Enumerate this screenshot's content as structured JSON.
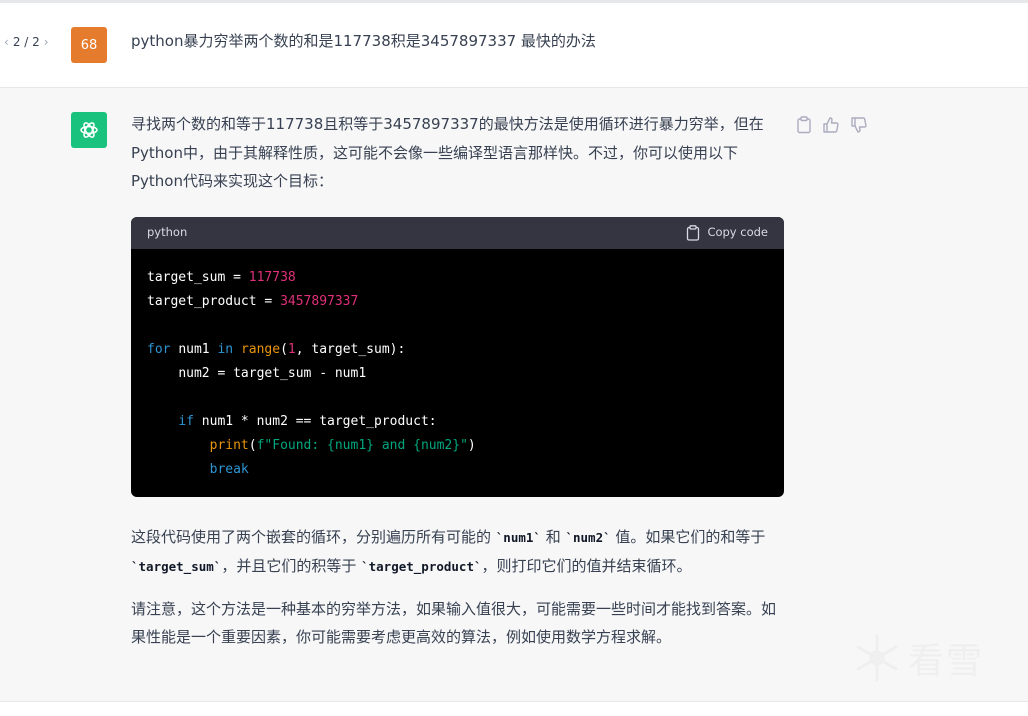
{
  "user": {
    "pager": "2 / 2",
    "avatar_text": "68",
    "message": "python暴力穷举两个数的和是117738积是3457897337 最快的办法"
  },
  "assistant": {
    "intro": "寻找两个数的和等于117738且积等于3457897337的最快方法是使用循环进行暴力穷举，但在Python中，由于其解释性质，这可能不会像一些编译型语言那样快。不过，你可以使用以下Python代码来实现这个目标：",
    "code": {
      "language": "python",
      "copy_label": "Copy code",
      "lines": {
        "l1": "target_sum",
        "l1v": "117738",
        "l2": "target_product",
        "l2v": "3457897337",
        "for_kw": "for",
        "num1": "num1",
        "in_kw": "in",
        "range_fn": "range",
        "range_start": "1",
        "range_rest": "target_sum):",
        "assign_num2": "num2 = target_sum - num1",
        "if_kw": "if",
        "if_rest": "num1 * num2 == target_product:",
        "print_fn": "print",
        "print_str": "f\"Found: {num1} and {num2}\"",
        "break_kw": "break"
      }
    },
    "para2": {
      "t1": "这段代码使用了两个嵌套的循环，分别遍历所有可能的 ",
      "c1": "`num1`",
      "t2": " 和 ",
      "c2": "`num2`",
      "t3": " 值。如果它们的和等于 ",
      "c3": "`target_sum`",
      "t4": "，并且它们的积等于 ",
      "c4": "`target_product`",
      "t5": "，则打印它们的值并结束循环。"
    },
    "para3": "请注意，这个方法是一种基本的穷举方法，如果输入值很大，可能需要一些时间才能找到答案。如果性能是一个重要因素，你可能需要考虑更高效的算法，例如使用数学方程求解。"
  },
  "watermark": {
    "text": "看雪"
  },
  "colors": {
    "user_avatar": "#e57c2d",
    "bot_avatar": "#19c37d",
    "code_bg": "#000000",
    "code_header": "#343541"
  }
}
